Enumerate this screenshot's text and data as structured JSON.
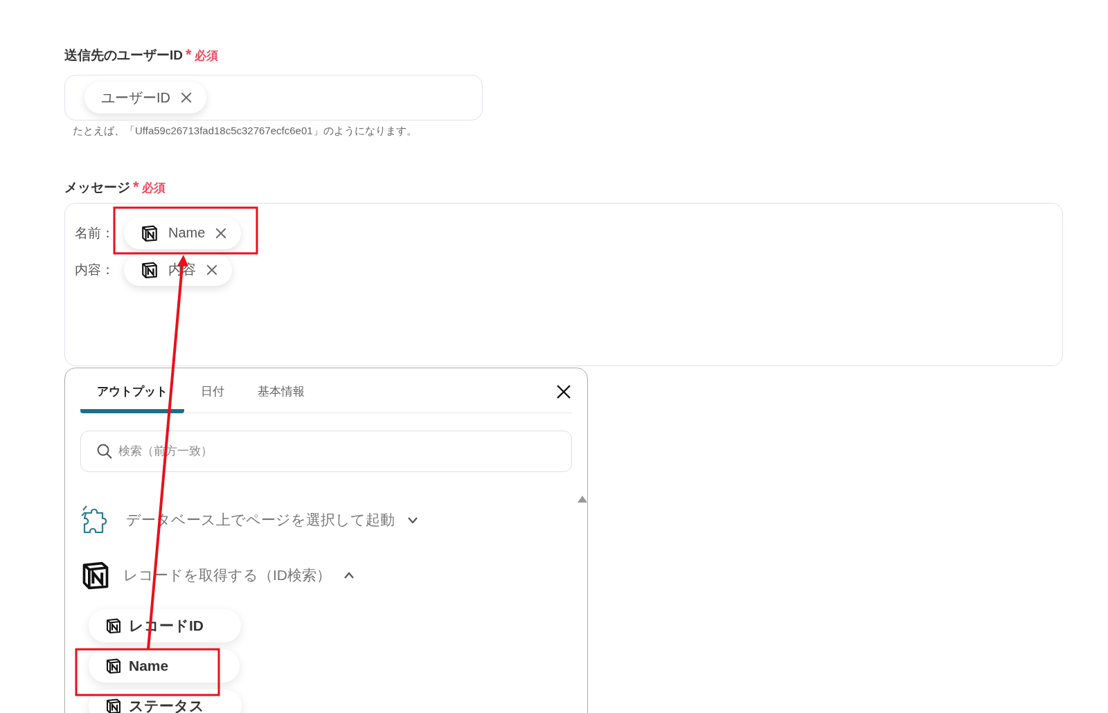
{
  "user_id_field": {
    "label": "送信先のユーザーID",
    "required_mark": "*",
    "required": "必須",
    "tokens": [
      {
        "label": "ユーザーID"
      }
    ],
    "hint": "たとえば、「Uffa59c26713fad18c5c32767ecfc6e01」のようになります。"
  },
  "message_field": {
    "label": "メッセージ",
    "required_mark": "*",
    "required": "必須",
    "lines": [
      {
        "prefix": "名前：",
        "token": "Name"
      },
      {
        "prefix": "内容：",
        "token": "内容"
      }
    ]
  },
  "output_panel": {
    "tabs": [
      {
        "label": "アウトプット",
        "selected": true
      },
      {
        "label": "日付",
        "selected": false
      },
      {
        "label": "基本情報",
        "selected": false
      }
    ],
    "search": {
      "placeholder": "検索（前方一致）"
    },
    "groups": [
      {
        "kind": "trigger",
        "title": "データベース上でページを選択して起動",
        "expanded": false
      },
      {
        "kind": "notion",
        "title": "レコードを取得する（ID検索）",
        "expanded": true,
        "items": [
          "レコードID",
          "Name",
          "ステータス"
        ]
      }
    ]
  }
}
